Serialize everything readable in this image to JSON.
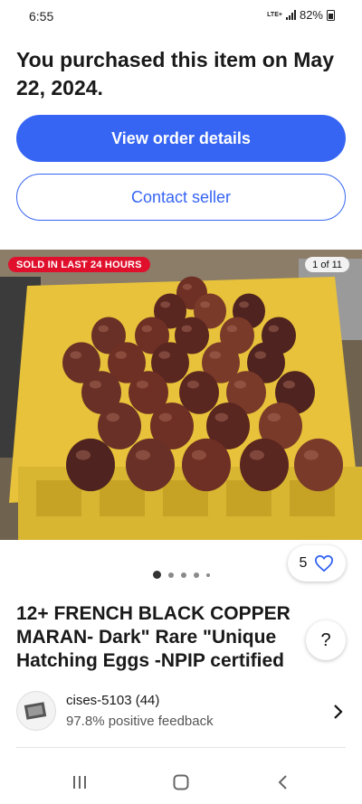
{
  "status_bar": {
    "time": "6:55",
    "network": "LTE+",
    "battery": "82%"
  },
  "purchase": {
    "message": "You purchased this item on May 22, 2024."
  },
  "actions": {
    "view_order_label": "View order details",
    "contact_seller_label": "Contact seller"
  },
  "gallery": {
    "badge": "SOLD IN LAST 24 HOURS",
    "counter": "1 of 11",
    "watch_count": "5",
    "page_dots": 5,
    "active_dot": 0
  },
  "item": {
    "title": "12+ FRENCH BLACK COPPER MARAN- Dark\" Rare \"Unique Hatching Eggs -NPIP certified"
  },
  "seller": {
    "name": "cises-5103 (44)",
    "feedback": "97.8% positive feedback"
  },
  "help": {
    "label": "?"
  },
  "nav": {
    "recents_icon": "recents-icon",
    "home_icon": "home-icon",
    "back_icon": "back-icon"
  },
  "colors": {
    "primary": "#3665f3",
    "sold_badge": "#e0102d"
  }
}
